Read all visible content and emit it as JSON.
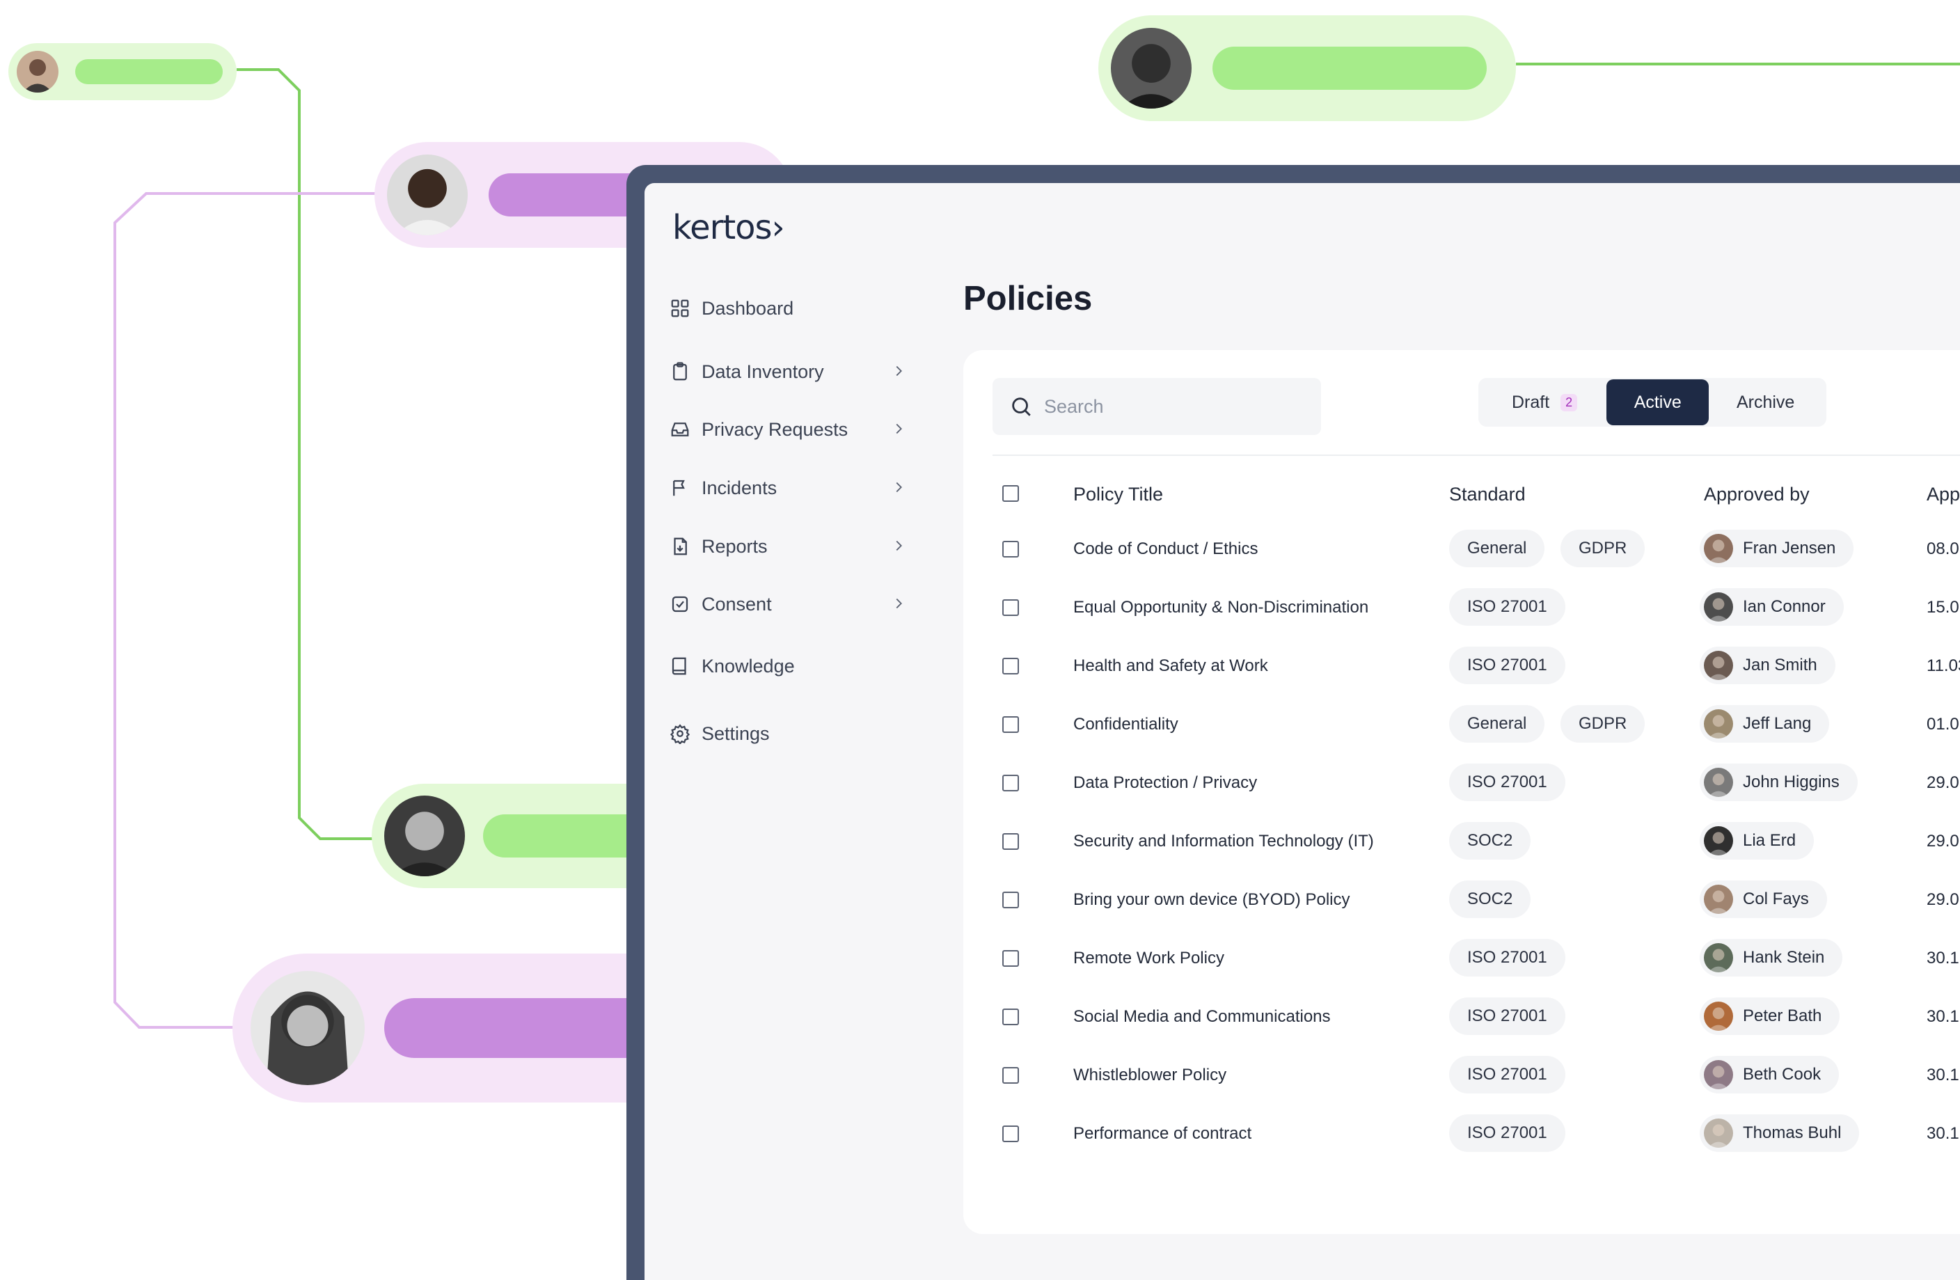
{
  "brand": {
    "logo_text": "kertos›"
  },
  "colors": {
    "green_pill": "#e3f9d6",
    "green_bar": "#a6ec8a",
    "purple_pill": "#f6e5f8",
    "purple_bar": "#c78bdd",
    "frame": "#495570",
    "active_tab": "#1e2a45"
  },
  "floating_users": [
    {
      "id": "user-1",
      "theme": "green"
    },
    {
      "id": "user-2",
      "theme": "green"
    },
    {
      "id": "user-3",
      "theme": "purple"
    },
    {
      "id": "user-4",
      "theme": "green"
    },
    {
      "id": "user-5",
      "theme": "purple"
    }
  ],
  "sidebar": {
    "items": [
      {
        "label": "Dashboard",
        "icon": "grid-icon",
        "has_chevron": false
      },
      {
        "label": "Data Inventory",
        "icon": "clipboard-icon",
        "has_chevron": true
      },
      {
        "label": "Privacy Requests",
        "icon": "inbox-icon",
        "has_chevron": true
      },
      {
        "label": "Incidents",
        "icon": "flag-icon",
        "has_chevron": true
      },
      {
        "label": "Reports",
        "icon": "document-icon",
        "has_chevron": true
      },
      {
        "label": "Consent",
        "icon": "check-square-icon",
        "has_chevron": true
      },
      {
        "label": "Knowledge",
        "icon": "book-icon",
        "has_chevron": false
      },
      {
        "label": "Settings",
        "icon": "gear-icon",
        "has_chevron": false
      }
    ]
  },
  "main": {
    "title": "Policies",
    "search": {
      "placeholder": "Search",
      "value": ""
    },
    "tabs": [
      {
        "label": "Draft",
        "count": "2",
        "selected": false
      },
      {
        "label": "Active",
        "selected": true
      },
      {
        "label": "Archive",
        "selected": false
      }
    ],
    "table": {
      "columns": [
        "Policy Title",
        "Standard",
        "Approved by",
        "App"
      ],
      "rows": [
        {
          "title": "Code of Conduct / Ethics",
          "standards": [
            "General",
            "GDPR"
          ],
          "approver": "Fran Jensen",
          "date": "08.0"
        },
        {
          "title": "Equal Opportunity & Non-Discrimination",
          "standards": [
            "ISO 27001"
          ],
          "approver": "Ian Connor",
          "date": "15.0"
        },
        {
          "title": "Health and Safety at Work",
          "standards": [
            "ISO 27001"
          ],
          "approver": "Jan Smith",
          "date": "11.03"
        },
        {
          "title": "Confidentiality",
          "standards": [
            "General",
            "GDPR"
          ],
          "approver": "Jeff Lang",
          "date": "01.0"
        },
        {
          "title": "Data Protection / Privacy",
          "standards": [
            "ISO 27001"
          ],
          "approver": "John Higgins",
          "date": "29.0"
        },
        {
          "title": "Security and Information Technology (IT)",
          "standards": [
            "SOC2"
          ],
          "approver": "Lia Erd",
          "date": "29.0"
        },
        {
          "title": "Bring your own device (BYOD) Policy",
          "standards": [
            "SOC2"
          ],
          "approver": "Col Fays",
          "date": "29.0"
        },
        {
          "title": "Remote Work Policy",
          "standards": [
            "ISO 27001"
          ],
          "approver": "Hank Stein",
          "date": "30.1"
        },
        {
          "title": "Social Media and Communications",
          "standards": [
            "ISO 27001"
          ],
          "approver": "Peter Bath",
          "date": "30.1"
        },
        {
          "title": "Whistleblower Policy",
          "standards": [
            "ISO 27001"
          ],
          "approver": "Beth Cook",
          "date": "30.1"
        },
        {
          "title": "Performance of contract",
          "standards": [
            "ISO 27001"
          ],
          "approver": "Thomas Buhl",
          "date": "30.1"
        }
      ]
    }
  }
}
